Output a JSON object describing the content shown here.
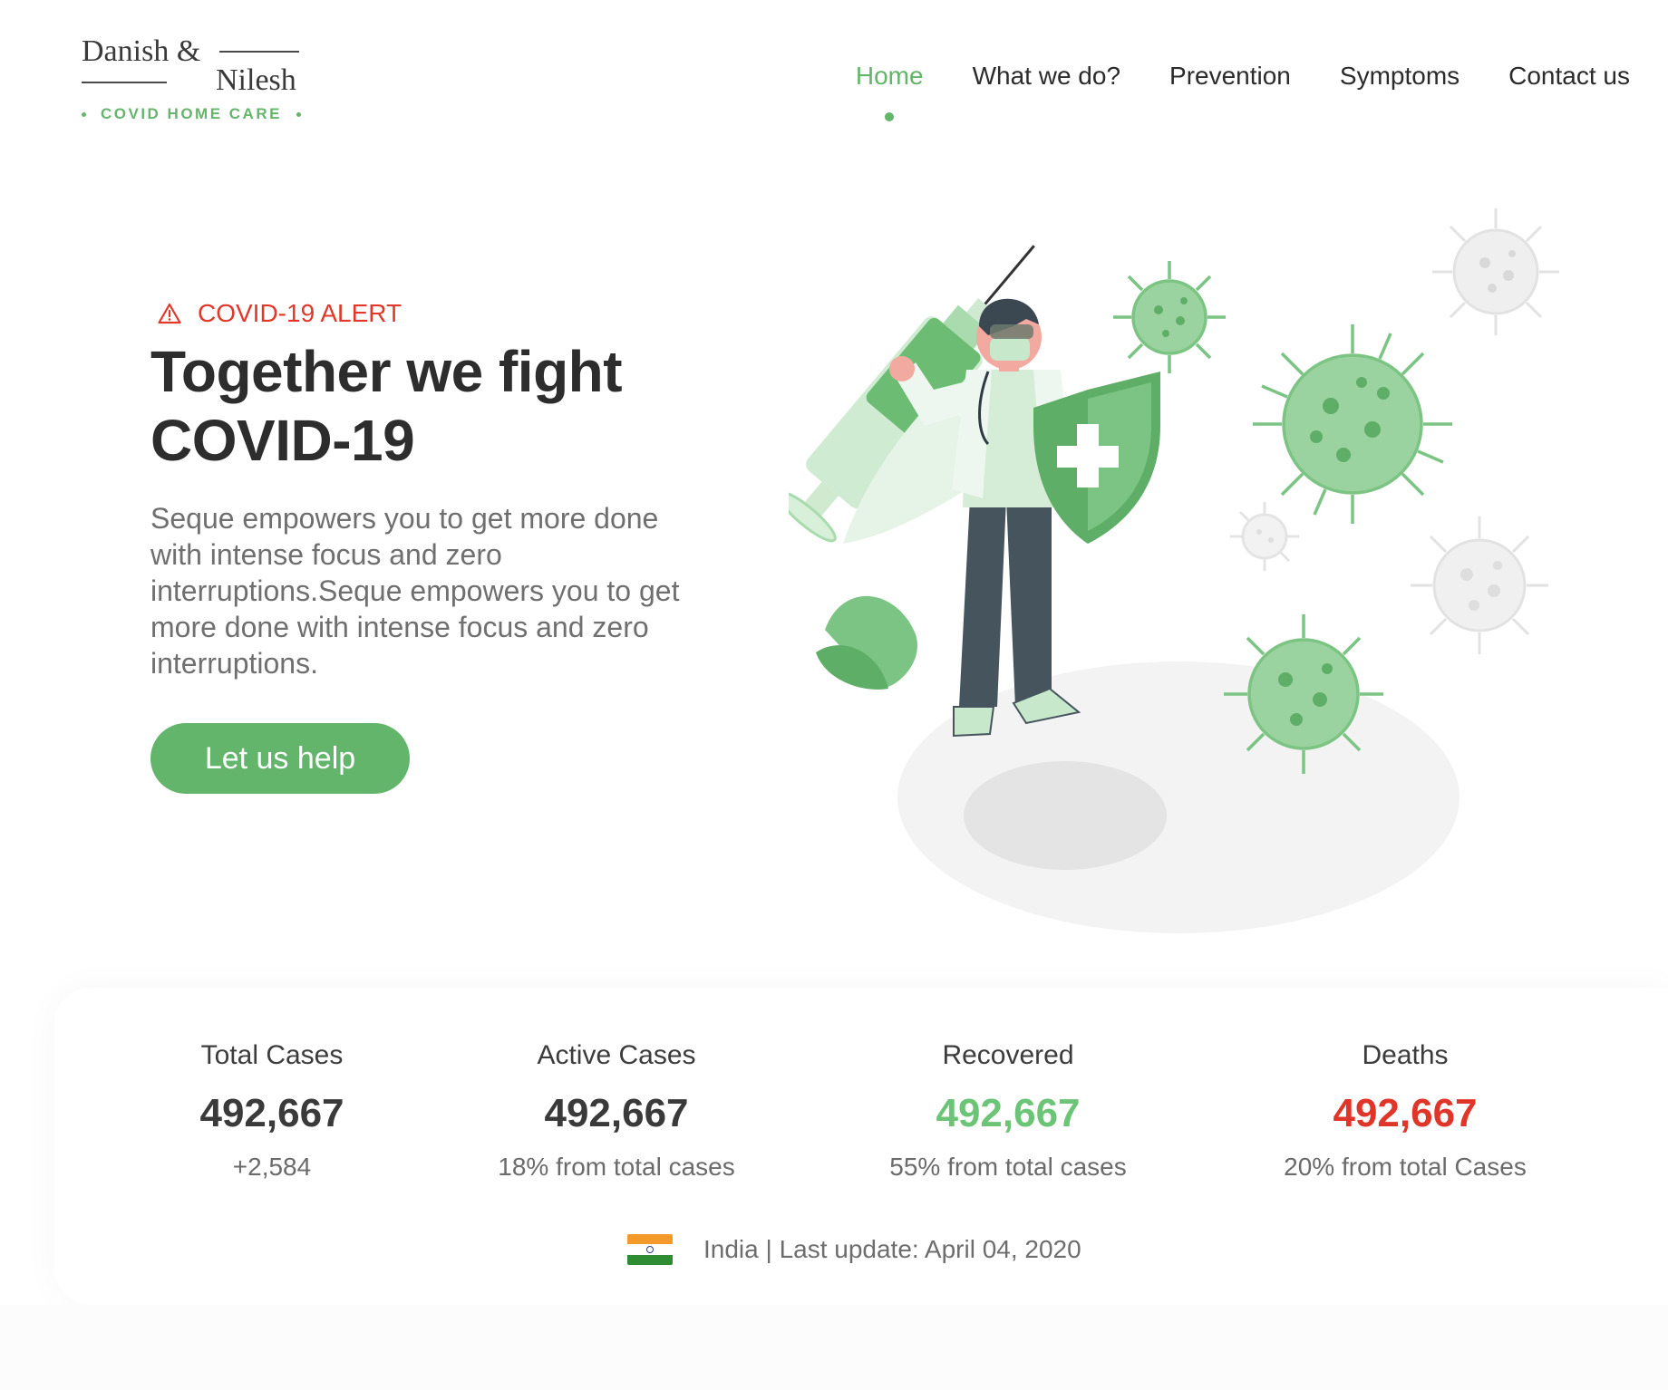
{
  "brand": {
    "line1": "Danish &",
    "line2": "Nilesh",
    "subtitle": "COVID HOME CARE",
    "accent_color": "#63b56b"
  },
  "nav": {
    "items": [
      {
        "label": "Home",
        "active": true
      },
      {
        "label": "What we do?",
        "active": false
      },
      {
        "label": "Prevention",
        "active": false
      },
      {
        "label": "Symptoms",
        "active": false
      },
      {
        "label": "Contact us",
        "active": false
      }
    ]
  },
  "hero": {
    "alert_icon": "warning-triangle-icon",
    "alert_text": "COVID-19 ALERT",
    "alert_color": "#e0382b",
    "title_line1": "Together we fight",
    "title_line2": "COVID-19",
    "description": "Seque empowers you to get more done with intense focus and zero interruptions.Seque empowers you to get more done with intense focus and zero interruptions.",
    "cta_label": "Let us help"
  },
  "stats": [
    {
      "label": "Total Cases",
      "value": "492,667",
      "sub": "+2,584",
      "color": "#3a3a3a"
    },
    {
      "label": "Active Cases",
      "value": "492,667",
      "sub": "18% from total cases",
      "color": "#3a3a3a"
    },
    {
      "label": "Recovered",
      "value": "492,667",
      "sub": "55% from total cases",
      "color": "#6cc477"
    },
    {
      "label": "Deaths",
      "value": "492,667",
      "sub": "20% from total Cases",
      "color": "#e0362a"
    }
  ],
  "update": {
    "flag_icon": "india-flag-icon",
    "country": "India",
    "separator": "|",
    "text": "Last update: April 04, 2020"
  }
}
